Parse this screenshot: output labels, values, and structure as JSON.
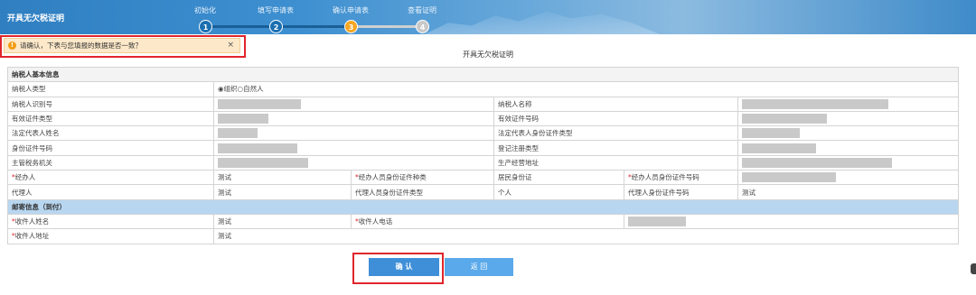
{
  "header": {
    "app_title": "开具无欠税证明",
    "steps": [
      {
        "number": "1",
        "label": "初始化"
      },
      {
        "number": "2",
        "label": "填写申请表"
      },
      {
        "number": "3",
        "label": "确认申请表"
      },
      {
        "number": "4",
        "label": "查看证明"
      }
    ],
    "colors": {
      "done": "#1a6fb0",
      "current": "#f5a623",
      "pending": "#c8c8c8"
    }
  },
  "alert": {
    "icon": "warning-icon",
    "text": "请确认，下表与您填报的数据是否一致？",
    "close": "×"
  },
  "form": {
    "title": "开具无欠税证明",
    "section_basic": "纳税人基本信息",
    "taxpayer_type_label": "纳税人类型",
    "taxpayer_type_value": "◉组织○自然人",
    "tax_id_label": "纳税人识别号",
    "taxpayer_name_label": "纳税人名称",
    "valid_id_type_label": "有效证件类型",
    "valid_id_number_label": "有效证件号码",
    "legal_rep_name_label": "法定代表人姓名",
    "legal_rep_id_type_label": "法定代表人身份证件类型",
    "id_number_label": "身份证件号码",
    "registration_type_label": "登记注册类型",
    "tax_authority_label": "主管税务机关",
    "business_address_label": "生产经营地址",
    "handler_label": "经办人",
    "handler_value": "测试",
    "handler_id_type_label": "经办人员身份证件种类",
    "handler_id_type_value": "居民身份证",
    "handler_id_number_label": "经办人员身份证件号码",
    "agent_label": "代理人",
    "agent_value": "测试",
    "agent_id_type_label": "代理人员身份证件类型",
    "agent_id_type_value": "个人",
    "agent_id_number_label": "代理人身份证件号码",
    "agent_id_number_value": "测试",
    "section_mail": "邮寄信息（到付）",
    "recipient_name_label": "收件人姓名",
    "recipient_name_value": "测试",
    "recipient_phone_label": "收件人电话",
    "recipient_address_label": "收件人地址",
    "recipient_address_value": "测试",
    "required_mark": "*"
  },
  "buttons": {
    "confirm": "确 认",
    "back": "返 回"
  }
}
